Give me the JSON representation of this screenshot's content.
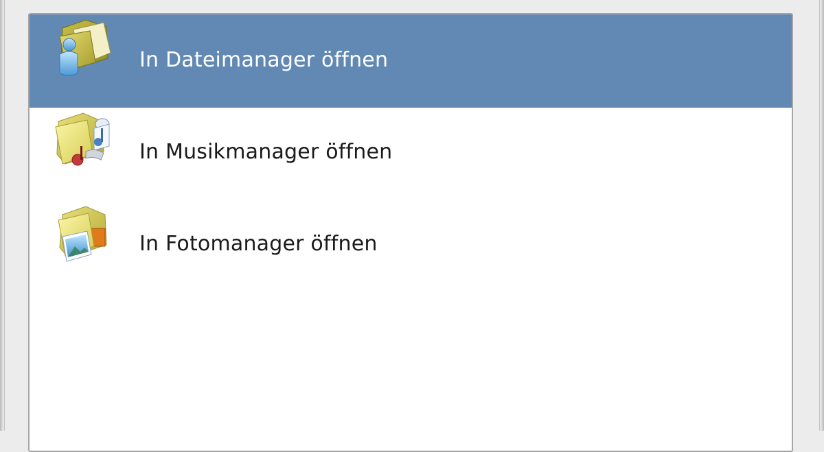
{
  "list": {
    "items": [
      {
        "label": "In Dateimanager öffnen",
        "icon": "file-manager-folder-icon",
        "selected": true
      },
      {
        "label": "In Musikmanager öffnen",
        "icon": "music-folder-icon",
        "selected": false
      },
      {
        "label": "In Fotomanager öffnen",
        "icon": "photo-folder-icon",
        "selected": false
      }
    ]
  },
  "colors": {
    "selection": "#6189b4",
    "window_background": "#ececec",
    "list_background": "#ffffff"
  }
}
